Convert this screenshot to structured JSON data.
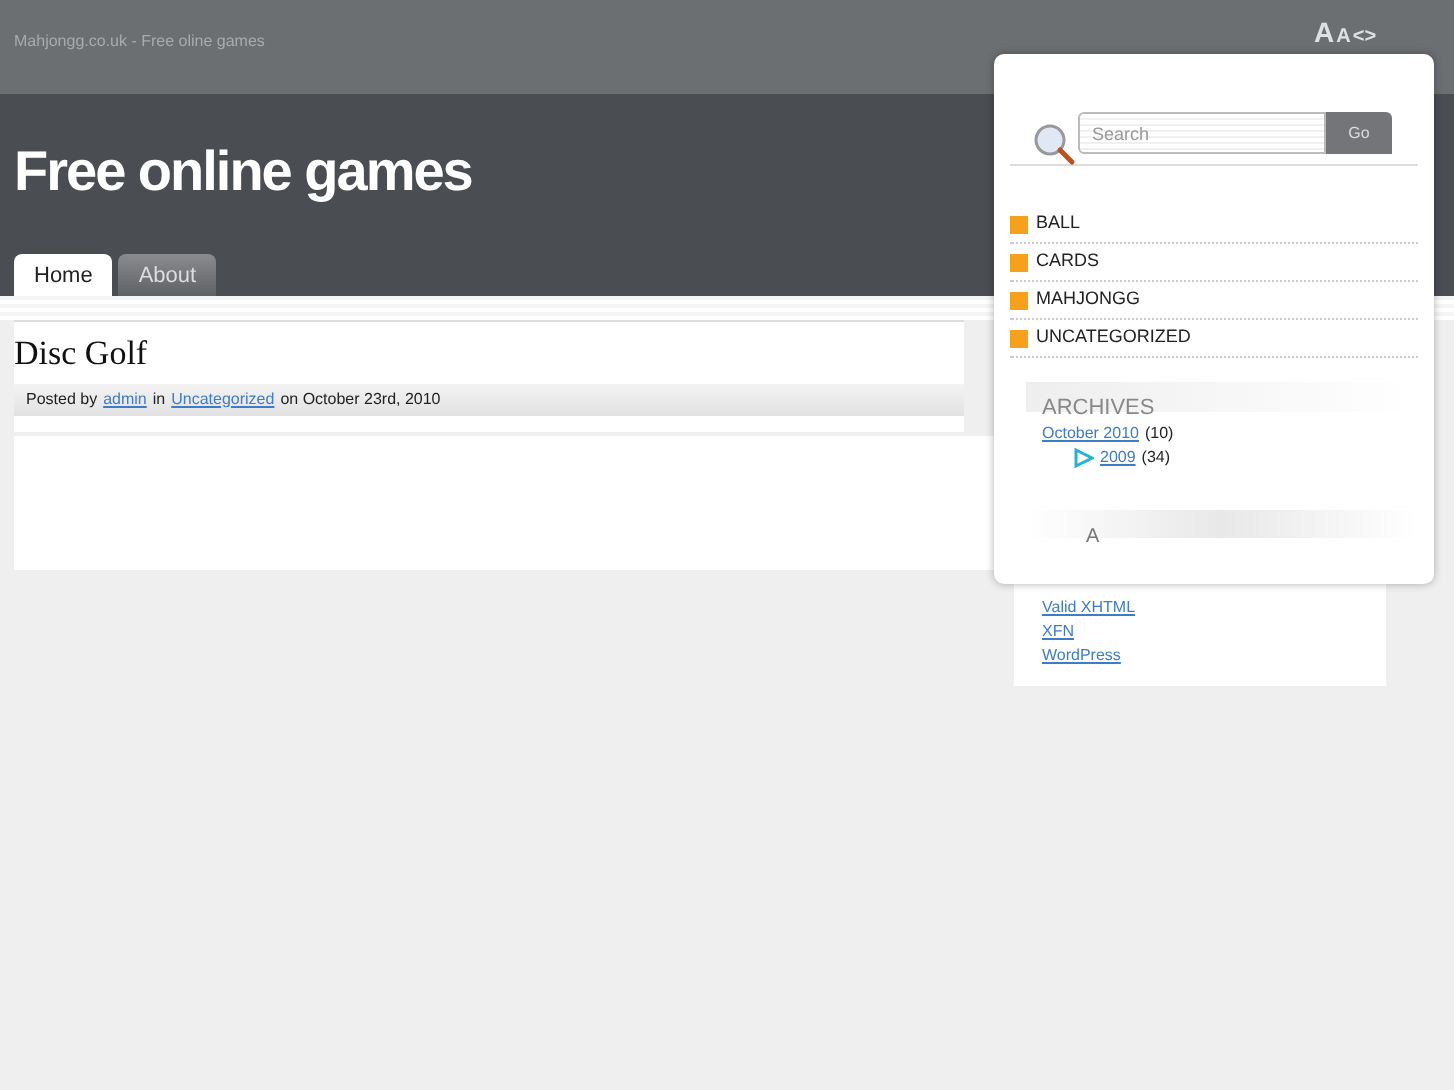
{
  "header": {
    "tagline": "Mahjongg.co.uk - Free oline games",
    "title": "Free online games",
    "font_controls": [
      "A",
      "A",
      "<>"
    ]
  },
  "tabs": [
    {
      "label": "Home",
      "selected": true
    },
    {
      "label": "About",
      "selected": false
    }
  ],
  "post": {
    "title": "Disc Golf",
    "meta": {
      "prefix": "Posted by",
      "author": "admin",
      "middle": "in",
      "category": "Uncategorized",
      "suffix": "on October 23rd, 2010"
    }
  },
  "sidebar": {
    "search": {
      "placeholder": "Search",
      "button": "Go"
    },
    "categories": [
      "BALL",
      "CARDS",
      "MAHJONGG",
      "UNCATEGORIZED"
    ],
    "archives": {
      "heading": "ARCHIVES",
      "items": [
        {
          "link": "October 2010",
          "count": "(10)"
        },
        {
          "link": "2009",
          "count": "(34)"
        }
      ]
    },
    "meta": {
      "heading": "A",
      "links": [
        "Valid XHTML",
        "XFN",
        "WordPress"
      ]
    }
  }
}
